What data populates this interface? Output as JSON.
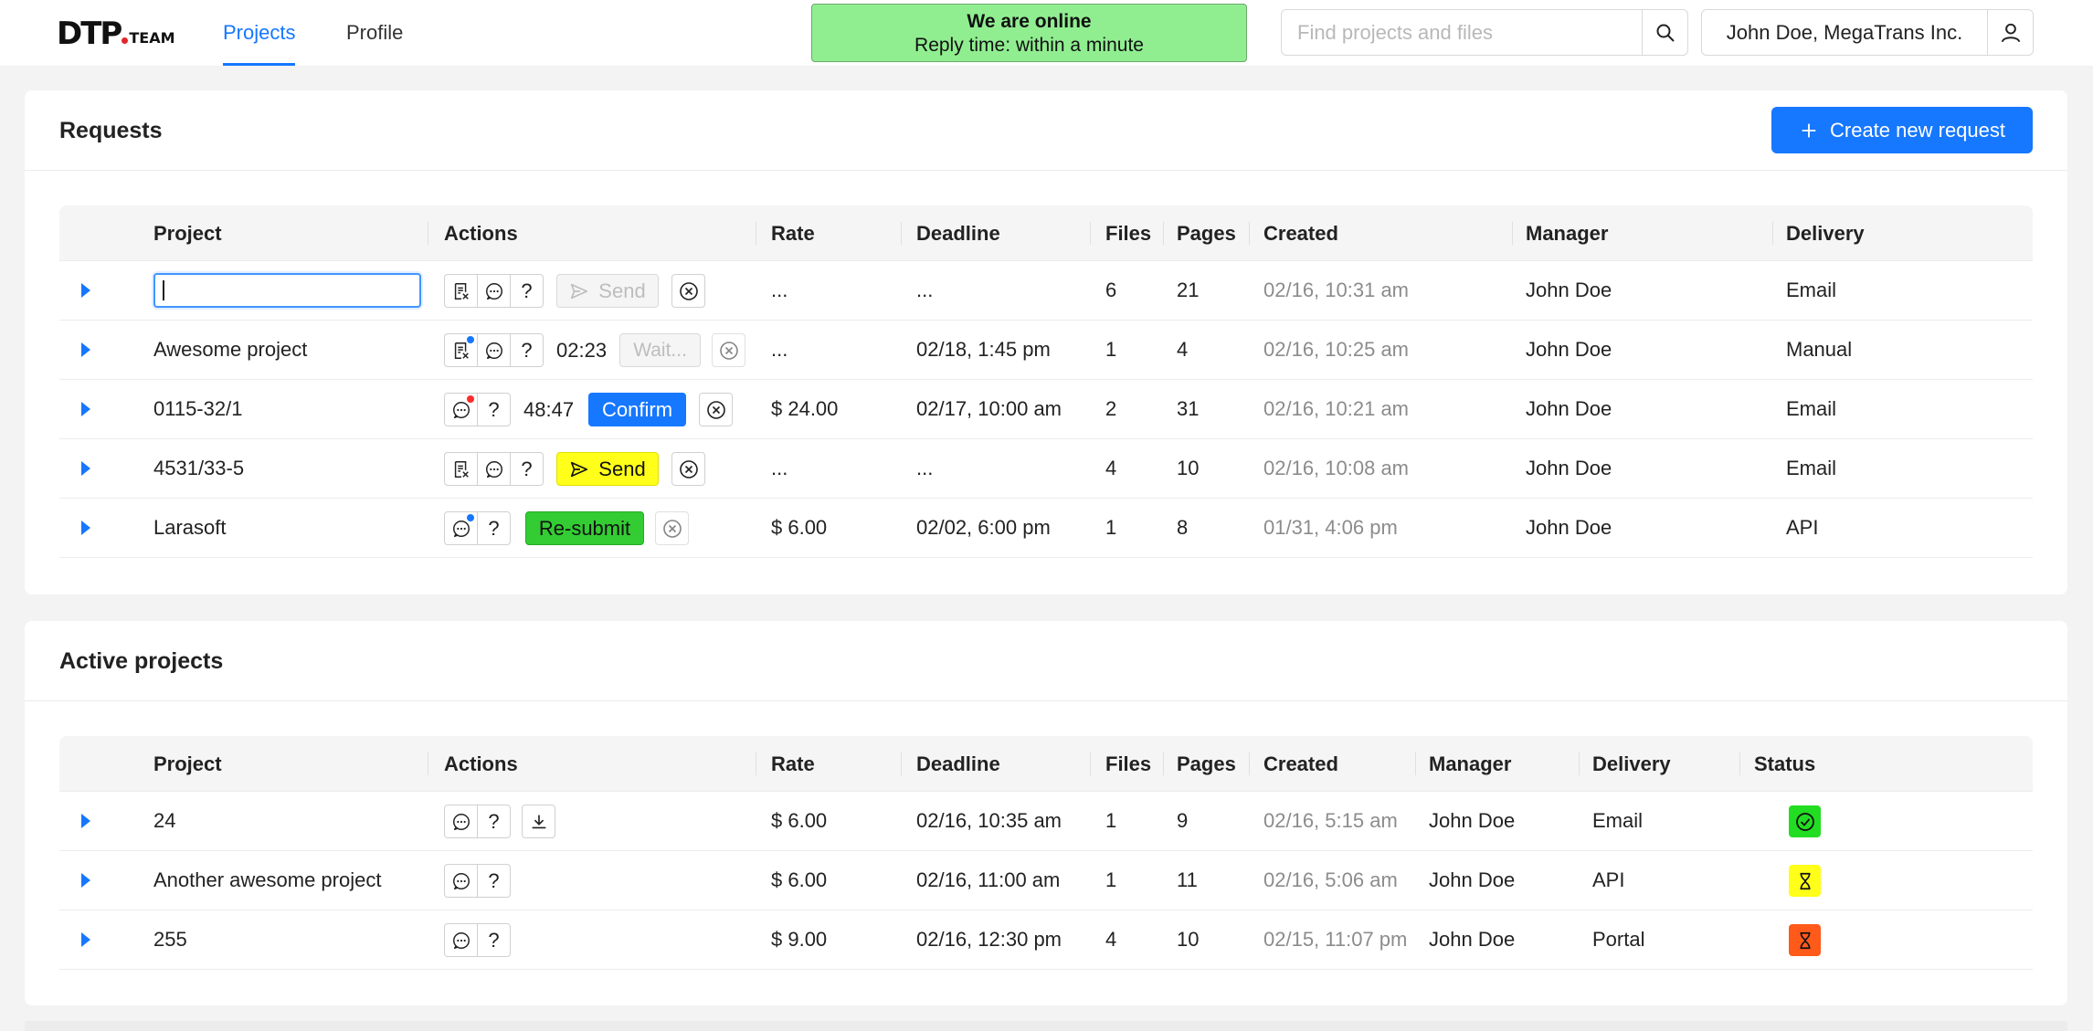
{
  "header": {
    "logo_main": "DTP",
    "logo_small": "TEAM",
    "tabs": [
      {
        "label": "Projects",
        "active": true
      },
      {
        "label": "Profile",
        "active": false
      }
    ],
    "online_title": "We are online",
    "online_subtitle": "Reply time: within a minute",
    "search_placeholder": "Find projects and files",
    "user_name": "John Doe, MegaTrans Inc."
  },
  "colors": {
    "accent": "#1677ff",
    "online_bg": "#90ee90",
    "send_yellow": "#ffff1a",
    "resubmit_green": "#33cc33",
    "status_done": "#22dd22",
    "status_waiting": "#ffff1a",
    "status_late": "#ff5a1a"
  },
  "requests": {
    "title": "Requests",
    "create_label": "Create new request",
    "columns": [
      "Project",
      "Actions",
      "Rate",
      "Deadline",
      "Files",
      "Pages",
      "Created",
      "Manager",
      "Delivery"
    ],
    "rows": [
      {
        "project": "",
        "editing": true,
        "timer": "",
        "action_label": "Send",
        "rate": "...",
        "deadline": "...",
        "files": "6",
        "pages": "21",
        "created": "02/16, 10:31 am",
        "manager": "John Doe",
        "delivery": "Email"
      },
      {
        "project": "Awesome project",
        "timer": "02:23",
        "action_label": "Wait...",
        "rate": "...",
        "deadline": "02/18, 1:45 pm",
        "files": "1",
        "pages": "4",
        "created": "02/16, 10:25 am",
        "manager": "John Doe",
        "delivery": "Manual"
      },
      {
        "project": "0115-32/1",
        "timer": "48:47",
        "action_label": "Confirm",
        "rate": "$ 24.00",
        "deadline": "02/17, 10:00 am",
        "files": "2",
        "pages": "31",
        "created": "02/16, 10:21 am",
        "manager": "John Doe",
        "delivery": "Email"
      },
      {
        "project": "4531/33-5",
        "timer": "",
        "action_label": "Send",
        "rate": "...",
        "deadline": "...",
        "files": "4",
        "pages": "10",
        "created": "02/16, 10:08 am",
        "manager": "John Doe",
        "delivery": "Email"
      },
      {
        "project": "Larasoft",
        "timer": "",
        "action_label": "Re-submit",
        "rate": "$ 6.00",
        "deadline": "02/02, 6:00 pm",
        "files": "1",
        "pages": "8",
        "created": "01/31, 4:06 pm",
        "manager": "John Doe",
        "delivery": "API"
      }
    ]
  },
  "active": {
    "title": "Active projects",
    "columns": [
      "Project",
      "Actions",
      "Rate",
      "Deadline",
      "Files",
      "Pages",
      "Created",
      "Manager",
      "Delivery",
      "Status"
    ],
    "rows": [
      {
        "project": "24",
        "rate": "$ 6.00",
        "deadline": "02/16, 10:35 am",
        "files": "1",
        "pages": "9",
        "created": "02/16, 5:15 am",
        "manager": "John Doe",
        "delivery": "Email",
        "status": "completed"
      },
      {
        "project": "Another awesome project",
        "rate": "$ 6.00",
        "deadline": "02/16, 11:00 am",
        "files": "1",
        "pages": "11",
        "created": "02/16, 5:06 am",
        "manager": "John Doe",
        "delivery": "API",
        "status": "in-progress"
      },
      {
        "project": "255",
        "rate": "$ 9.00",
        "deadline": "02/16, 12:30 pm",
        "files": "4",
        "pages": "10",
        "created": "02/15, 11:07 pm",
        "manager": "John Doe",
        "delivery": "Portal",
        "status": "overdue"
      }
    ]
  }
}
